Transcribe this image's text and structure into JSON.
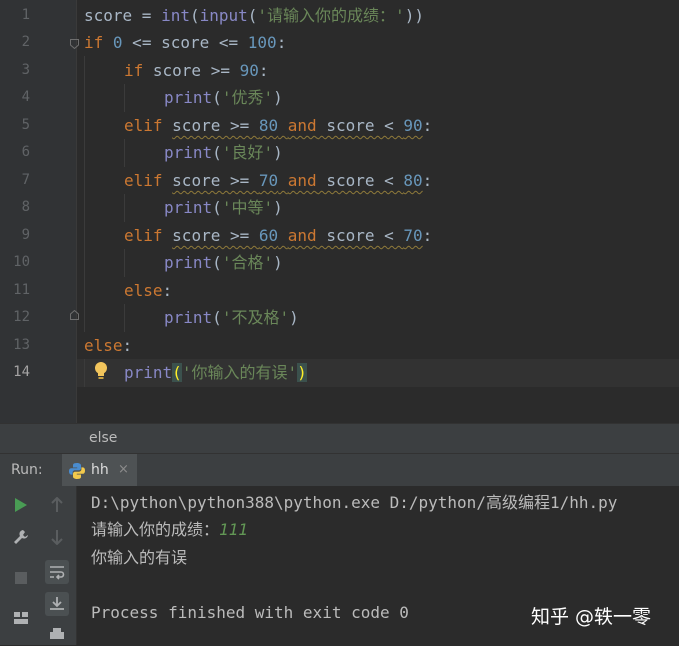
{
  "editor": {
    "line_numbers": [
      "1",
      "2",
      "3",
      "4",
      "5",
      "6",
      "7",
      "8",
      "9",
      "10",
      "11",
      "12",
      "13",
      "14"
    ],
    "current_line": "14",
    "lines": {
      "l1": {
        "a": "score = ",
        "fn1": "int",
        "b": "(",
        "fn2": "input",
        "c": "(",
        "s": "'请输入你的成绩：'",
        "d": "))"
      },
      "l2": {
        "kw": "if",
        "a": " ",
        "n1": "0",
        "b": " <= score <= ",
        "n2": "100",
        "c": ":"
      },
      "l3": {
        "kw": "if",
        "a": " score >= ",
        "n": "90",
        "c": ":"
      },
      "l4": {
        "fn": "print",
        "a": "(",
        "s": "'优秀'",
        "b": ")"
      },
      "l5": {
        "kw": "elif",
        "a": " ",
        "w1": "score >= ",
        "n1": "80",
        "w2": " ",
        "and": "and",
        "w3": " score < ",
        "n2": "90",
        "c": ":"
      },
      "l6": {
        "fn": "print",
        "a": "(",
        "s": "'良好'",
        "b": ")"
      },
      "l7": {
        "kw": "elif",
        "a": " ",
        "w1": "score >= ",
        "n1": "70",
        "w2": " ",
        "and": "and",
        "w3": " score < ",
        "n2": "80",
        "c": ":"
      },
      "l8": {
        "fn": "print",
        "a": "(",
        "s": "'中等'",
        "b": ")"
      },
      "l9": {
        "kw": "elif",
        "a": " ",
        "w1": "score >= ",
        "n1": "60",
        "w2": " ",
        "and": "and",
        "w3": " score < ",
        "n2": "70",
        "c": ":"
      },
      "l10": {
        "fn": "print",
        "a": "(",
        "s": "'合格'",
        "b": ")"
      },
      "l11": {
        "kw": "else",
        "c": ":"
      },
      "l12": {
        "fn": "print",
        "a": "(",
        "s": "'不及格'",
        "b": ")"
      },
      "l13": {
        "kw": "else",
        "c": ":"
      },
      "l14": {
        "fn": "print",
        "a": "(",
        "s": "'你输入的有误'",
        "b": ")"
      }
    }
  },
  "breadcrumb": {
    "text": "else"
  },
  "run": {
    "label": "Run:",
    "tab_name": "hh",
    "close_glyph": "×",
    "console": {
      "command": "D:\\python\\python388\\python.exe D:/python/高级编程1/hh.py",
      "prompt": "请输入你的成绩：",
      "input_value": "111",
      "output": "你输入的有误",
      "exit": "Process finished with exit code 0"
    }
  },
  "watermark": "知乎 @轶一零",
  "icons": {
    "rerun": "run-icon",
    "up": "up-arrow-icon",
    "wrench": "wrench-icon",
    "down": "down-arrow-icon",
    "stop": "stop-icon",
    "soft_wrap": "soft-wrap-icon",
    "scroll_end": "scroll-to-end-icon",
    "layout": "layout-icon",
    "print": "print-icon",
    "bulb": "lightbulb-icon"
  },
  "colors": {
    "background": "#2b2b2b",
    "keyword": "#cc7832",
    "number": "#6897bb",
    "builtin": "#8888c6",
    "string": "#6a8759",
    "text": "#a9b7c6",
    "run_green": "#499c54",
    "input_green": "#629755"
  }
}
